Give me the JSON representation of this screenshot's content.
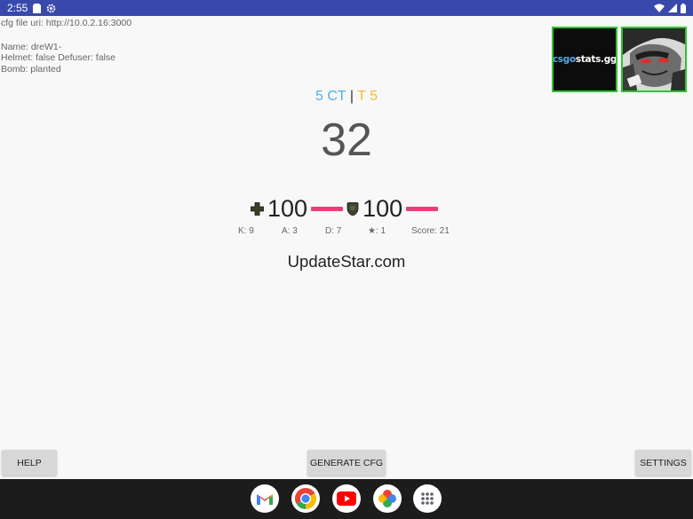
{
  "status_bar": {
    "time": "2:55",
    "icons": [
      "sim-card-icon",
      "settings-gear-icon",
      "wifi-icon",
      "signal-icon",
      "battery-icon"
    ],
    "background": "#3949ab"
  },
  "info": {
    "cfg_uri": "cfg file uri: http://10.0.2.16:3000",
    "name": "Name: dreW1-",
    "helmet_defuser": "Helmet: false Defuser: false",
    "bomb": "Bomb: planted"
  },
  "thumbnails": {
    "logo_blue": "csgo",
    "logo_white": "stats.gg"
  },
  "score": {
    "ct": "5 CT",
    "separator": "|",
    "t": "T 5",
    "ct_color": "#4fb0e8",
    "t_color": "#f2bf2f"
  },
  "round_time": "32",
  "vitals": {
    "health": "100",
    "armor": "100",
    "bar_color": "#e93e7b"
  },
  "stats": {
    "kills": "K: 9",
    "assists": "A: 3",
    "deaths": "D: 7",
    "mvps": "★: 1",
    "score": "Score: 21"
  },
  "watermark": "UpdateStar.com",
  "buttons": {
    "help": "HELP",
    "generate": "GENERATE CFG",
    "settings": "SETTINGS"
  },
  "dock": {
    "apps": [
      "gmail-icon",
      "chrome-icon",
      "youtube-icon",
      "photos-icon",
      "app-drawer-icon"
    ]
  }
}
